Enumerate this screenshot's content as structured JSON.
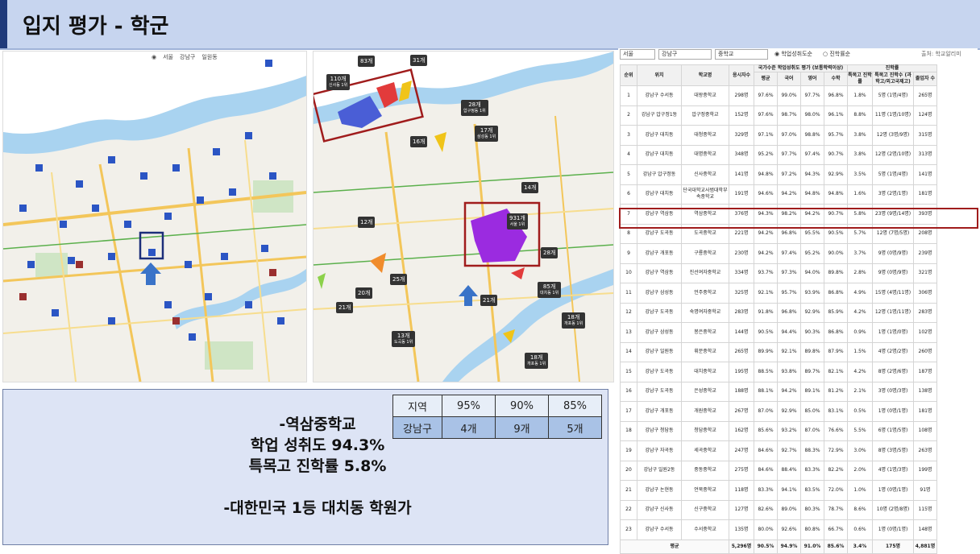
{
  "title": "입지 평가 - 학군",
  "left_map": {
    "toolbar": [
      "서울",
      "강남구",
      "일원동"
    ]
  },
  "right_map": {
    "markers": [
      {
        "count": "83개",
        "sub": ""
      },
      {
        "count": "31개",
        "sub": ""
      },
      {
        "count": "110개",
        "sub": "신사동 1위"
      },
      {
        "count": "28개",
        "sub": "압구정동 1위"
      },
      {
        "count": "17개",
        "sub": "삼성동 1위"
      },
      {
        "count": "16개",
        "sub": ""
      },
      {
        "count": "14개",
        "sub": ""
      },
      {
        "count": "12개",
        "sub": ""
      },
      {
        "count": "931개",
        "sub": "서울 1위"
      },
      {
        "count": "28개",
        "sub": ""
      },
      {
        "count": "25개",
        "sub": ""
      },
      {
        "count": "20개",
        "sub": ""
      },
      {
        "count": "21개",
        "sub": ""
      },
      {
        "count": "21개",
        "sub": ""
      },
      {
        "count": "85개",
        "sub": "대치동 1위"
      },
      {
        "count": "18개",
        "sub": "개포동 1위"
      },
      {
        "count": "13개",
        "sub": "도곡동 1위"
      },
      {
        "count": "18개",
        "sub": "개포동 1위"
      }
    ]
  },
  "summary": {
    "line1": "-역삼중학교",
    "line2": "학업 성취도 94.3%",
    "line3": "특목고 진학률 5.8%",
    "line4": "-대한민국 1등 대치동 학원가"
  },
  "rate_table": {
    "header": [
      "지역",
      "95%",
      "90%",
      "85%"
    ],
    "row": [
      "강남구",
      "4개",
      "9개",
      "5개"
    ]
  },
  "rank_panel": {
    "filters": {
      "sido": "서울",
      "gu": "강남구",
      "level": "중학교",
      "radio1": "학업성취도순",
      "radio2": "진학률순",
      "source": "출처: 학교알리미"
    },
    "group_headers": {
      "achievement": "국가수준 학업성취도 평가 (보통학력이상)",
      "advancement": "진학률"
    },
    "columns": [
      "순위",
      "위치",
      "학교명",
      "응시자수",
      "평균",
      "국어",
      "영어",
      "수학",
      "특목고 진학률",
      "특목고 진학수 (과학고/외고국제고)",
      "졸업자 수"
    ],
    "rows": [
      [
        "1",
        "강남구 수서동",
        "대왕중학교",
        "298명",
        "97.6%",
        "99.0%",
        "97.7%",
        "96.8%",
        "1.8%",
        "5명 (1명/4명)",
        "265명"
      ],
      [
        "2",
        "강남구 압구정1동",
        "압구정중학교",
        "152명",
        "97.6%",
        "98.7%",
        "98.0%",
        "96.1%",
        "8.8%",
        "11명 (1명/10명)",
        "124명"
      ],
      [
        "3",
        "강남구 대치동",
        "대청중학교",
        "329명",
        "97.1%",
        "97.0%",
        "98.8%",
        "95.7%",
        "3.8%",
        "12명 (3명/9명)",
        "315명"
      ],
      [
        "4",
        "강남구 대치동",
        "대명중학교",
        "348명",
        "95.2%",
        "97.7%",
        "97.4%",
        "90.7%",
        "3.8%",
        "12명 (2명/10명)",
        "313명"
      ],
      [
        "5",
        "강남구 압구정동",
        "신사중학교",
        "141명",
        "94.8%",
        "97.2%",
        "94.3%",
        "92.9%",
        "3.5%",
        "5명 (1명/4명)",
        "141명"
      ],
      [
        "6",
        "강남구 대치동",
        "단국대학교사범대학부속중학교",
        "191명",
        "94.6%",
        "94.2%",
        "94.8%",
        "94.8%",
        "1.6%",
        "3명 (2명/1명)",
        "181명"
      ],
      [
        "7",
        "강남구 역삼동",
        "역삼중학교",
        "376명",
        "94.3%",
        "98.2%",
        "94.2%",
        "90.7%",
        "5.8%",
        "23명 (9명/14명)",
        "393명"
      ],
      [
        "8",
        "강남구 도곡동",
        "도곡중학교",
        "221명",
        "94.2%",
        "96.8%",
        "95.5%",
        "90.5%",
        "5.7%",
        "12명 (7명/5명)",
        "208명"
      ],
      [
        "9",
        "강남구 개포동",
        "구룡중학교",
        "230명",
        "94.2%",
        "97.4%",
        "95.2%",
        "90.0%",
        "3.7%",
        "9명 (0명/9명)",
        "239명"
      ],
      [
        "10",
        "강남구 역삼동",
        "진선여자중학교",
        "334명",
        "93.7%",
        "97.3%",
        "94.0%",
        "89.8%",
        "2.8%",
        "9명 (0명/9명)",
        "321명"
      ],
      [
        "11",
        "강남구 삼성동",
        "언주중학교",
        "325명",
        "92.1%",
        "95.7%",
        "93.9%",
        "86.8%",
        "4.9%",
        "15명 (4명/11명)",
        "306명"
      ],
      [
        "12",
        "강남구 도곡동",
        "숙명여자중학교",
        "283명",
        "91.8%",
        "96.8%",
        "92.9%",
        "85.9%",
        "4.2%",
        "12명 (1명/11명)",
        "283명"
      ],
      [
        "13",
        "강남구 삼성동",
        "봉은중학교",
        "144명",
        "90.5%",
        "94.4%",
        "90.3%",
        "86.8%",
        "0.9%",
        "1명 (1명/0명)",
        "102명"
      ],
      [
        "14",
        "강남구 일원동",
        "휘문중학교",
        "265명",
        "89.9%",
        "92.1%",
        "89.8%",
        "87.9%",
        "1.5%",
        "4명 (2명/2명)",
        "260명"
      ],
      [
        "15",
        "강남구 도곡동",
        "대치중학교",
        "195명",
        "88.5%",
        "93.8%",
        "89.7%",
        "82.1%",
        "4.2%",
        "8명 (2명/6명)",
        "187명"
      ],
      [
        "16",
        "강남구 도곡동",
        "은성중학교",
        "188명",
        "88.1%",
        "94.2%",
        "89.1%",
        "81.2%",
        "2.1%",
        "3명 (0명/3명)",
        "138명"
      ],
      [
        "17",
        "강남구 개포동",
        "개원중학교",
        "267명",
        "87.0%",
        "92.9%",
        "85.0%",
        "83.1%",
        "0.5%",
        "1명 (0명/1명)",
        "181명"
      ],
      [
        "18",
        "강남구 청담동",
        "청담중학교",
        "162명",
        "85.6%",
        "93.2%",
        "87.0%",
        "76.6%",
        "5.5%",
        "6명 (1명/5명)",
        "108명"
      ],
      [
        "19",
        "강남구 자곡동",
        "세곡중학교",
        "247명",
        "84.6%",
        "92.7%",
        "88.3%",
        "72.9%",
        "3.0%",
        "8명 (3명/5명)",
        "263명"
      ],
      [
        "20",
        "강남구 일원2동",
        "중동중학교",
        "275명",
        "84.6%",
        "88.4%",
        "83.3%",
        "82.2%",
        "2.0%",
        "4명 (1명/3명)",
        "199명"
      ],
      [
        "21",
        "강남구 논현동",
        "언북중학교",
        "118명",
        "83.3%",
        "94.1%",
        "83.5%",
        "72.0%",
        "1.0%",
        "1명 (0명/1명)",
        "91명"
      ],
      [
        "22",
        "강남구 신사동",
        "신구중학교",
        "127명",
        "82.6%",
        "89.0%",
        "80.3%",
        "78.7%",
        "8.6%",
        "10명 (2명/8명)",
        "115명"
      ],
      [
        "23",
        "강남구 수서동",
        "수서중학교",
        "135명",
        "80.0%",
        "92.6%",
        "80.8%",
        "66.7%",
        "0.6%",
        "1명 (0명/1명)",
        "148명"
      ]
    ],
    "footer": [
      "평균",
      "5,296명",
      "90.5%",
      "94.9%",
      "91.0%",
      "85.6%",
      "3.4%",
      "175명",
      "4,881명"
    ]
  },
  "colors": {
    "title_bg": "#c7d5ef",
    "highlight": "#a01c1c",
    "blue_arrow": "#3a73c8"
  }
}
